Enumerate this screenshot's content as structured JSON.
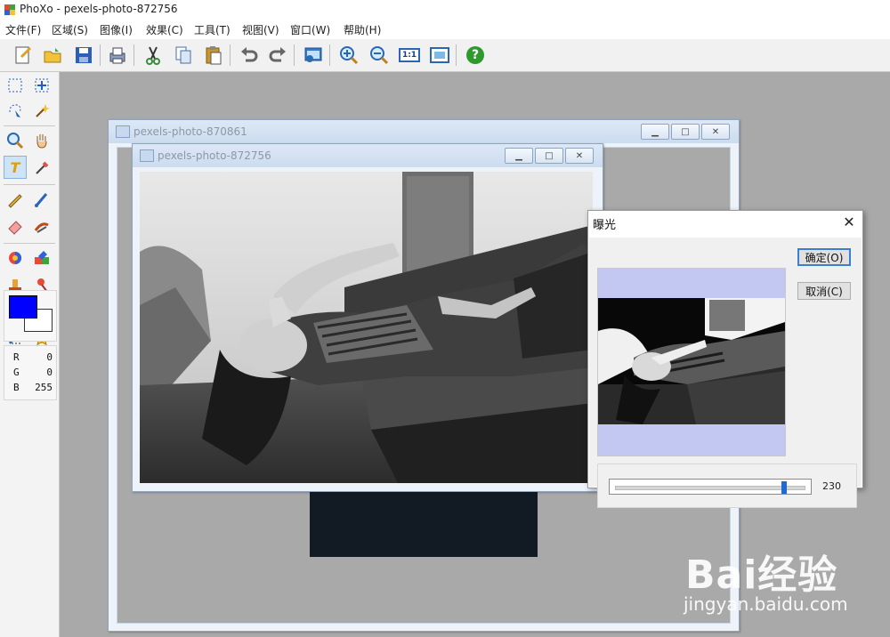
{
  "app": {
    "title": "PhoXo - pexels-photo-872756"
  },
  "menu": [
    "文件(F)",
    "区域(S)",
    "图像(I)",
    "效果(C)",
    "工具(T)",
    "视图(V)",
    "窗口(W)",
    "帮助(H)"
  ],
  "toolbar": {
    "buttons": [
      "new-icon",
      "open-icon",
      "save-icon",
      "print-icon",
      "cut-icon",
      "copy-icon",
      "paste-icon",
      "undo-icon",
      "redo-icon",
      "screen-capture-icon",
      "zoom-in-icon",
      "zoom-out-icon",
      "actual-size-icon",
      "fit-window-icon",
      "help-icon"
    ],
    "actual_size_label": "1:1",
    "help_label": "?"
  },
  "palette": {
    "tools": [
      "rect-select-icon",
      "move-select-icon",
      "lasso-icon",
      "magic-wand-icon",
      "zoom-icon",
      "hand-icon",
      "text-icon",
      "eyedropper-icon",
      "pencil-icon",
      "brush-icon",
      "eraser-icon",
      "smudge-icon",
      "fill-icon",
      "color-replace-icon",
      "stamp-icon",
      "pin-icon",
      "gradient-icon",
      "line-icon",
      "transform-icon",
      "star-icon"
    ],
    "text_tool_glyph": "T",
    "foreground_color": "#0000ff",
    "background_color": "#ffffff",
    "rgb": {
      "r_label": "R",
      "r_value": "0",
      "g_label": "G",
      "g_value": "0",
      "b_label": "B",
      "b_value": "255"
    }
  },
  "windows": {
    "back": {
      "title": "pexels-photo-870861"
    },
    "front": {
      "title": "pexels-photo-872756"
    }
  },
  "dialog": {
    "title": "曝光",
    "ok_label": "确定(O)",
    "cancel_label": "取消(C)",
    "slider_value": "230",
    "slider_fraction": 0.9
  },
  "watermark": {
    "logo": "Bai经验",
    "url": "jingyan.baidu.com"
  }
}
